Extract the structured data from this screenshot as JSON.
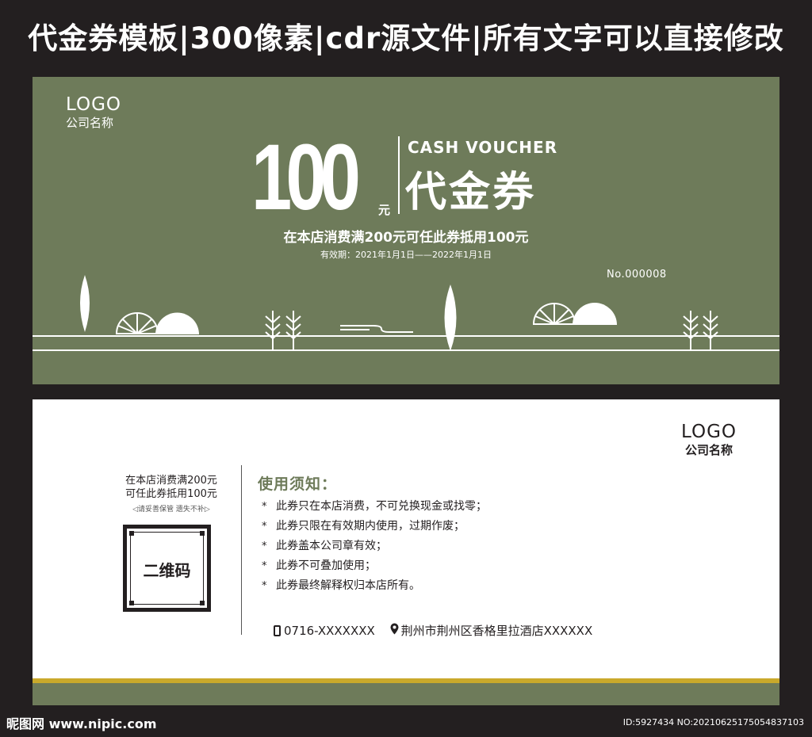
{
  "header": {
    "title": "代金券模板|300像素|cdr源文件|所有文字可以直接修改"
  },
  "front": {
    "logo": "LOGO",
    "company": "公司名称",
    "amount": "100",
    "currency": "元",
    "cash_voucher": "CASH VOUCHER",
    "voucher_cn": "代金券",
    "rule": "在本店消费满200元可任此券抵用100元",
    "validity": "有效期：2021年1月1日——2022年1月1日",
    "serial": "No.000008"
  },
  "back": {
    "logo": "LOGO",
    "company": "公司名称",
    "rule_line1": "在本店消费满200元",
    "rule_line2": "可任此券抵用100元",
    "keep_note": "◁请妥善保管  遗失不补▷",
    "qr_label": "二维码",
    "notes_title": "使用须知：",
    "notes": [
      "此券只在本店消费，不可兑换现金或找零；",
      "此券只限在有效期内使用，过期作废；",
      "此券盖本公司章有效；",
      "此券不可叠加使用；",
      "此券最终解释权归本店所有。"
    ],
    "note_bullet": "*",
    "phone": "0716-XXXXXXX",
    "address": "荆州市荆州区香格里拉酒店XXXXXX"
  },
  "watermark": {
    "site": "昵图网 www.nipic.com",
    "id": "ID:5927434 NO:20210625175054837103"
  },
  "colors": {
    "olive": "#6e7b5a",
    "gold": "#c9a92b",
    "dark": "#231f20",
    "white": "#ffffff"
  },
  "icons": [
    "phone-icon",
    "location-pin-icon",
    "leaf-tree-icon",
    "half-wheel-icon",
    "half-sun-icon",
    "sapling-icon"
  ]
}
